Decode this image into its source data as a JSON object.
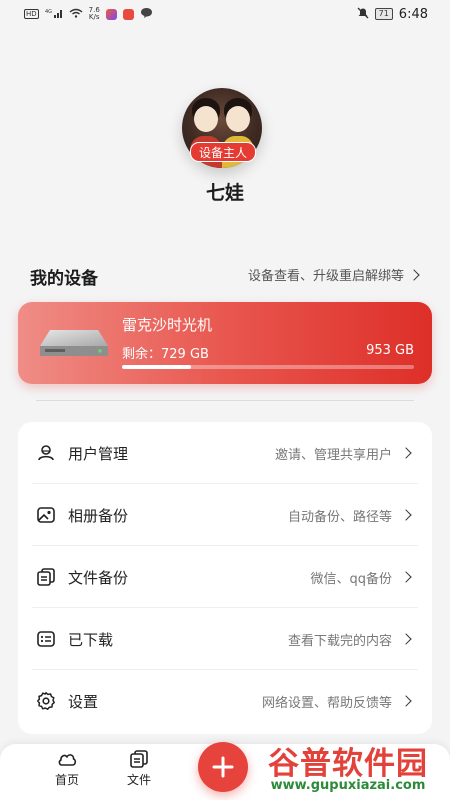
{
  "status_bar": {
    "hd": "HD",
    "signal_label": "4G",
    "speed_value": "7.6",
    "speed_unit": "K/s",
    "battery": "71",
    "time": "6:48"
  },
  "profile": {
    "badge": "设备主人",
    "name": "七娃"
  },
  "devices_section": {
    "title": "我的设备",
    "link": "设备查看、升级重启解绑等"
  },
  "device_card": {
    "name": "雷克沙时光机",
    "remaining_label": "剩余：729 GB",
    "total": "953 GB",
    "used_fraction": 0.235
  },
  "menu": {
    "items": [
      {
        "label": "用户管理",
        "hint": "邀请、管理共享用户",
        "icon": "user-icon"
      },
      {
        "label": "相册备份",
        "hint": "自动备份、路径等",
        "icon": "photo-icon"
      },
      {
        "label": "文件备份",
        "hint": "微信、qq备份",
        "icon": "files-icon"
      },
      {
        "label": "已下载",
        "hint": "查看下载完的内容",
        "icon": "download-list-icon"
      },
      {
        "label": "设置",
        "hint": "网络设置、帮助反馈等",
        "icon": "gear-icon"
      }
    ]
  },
  "bottom_nav": {
    "home": "首页",
    "files": "文件"
  },
  "watermark": {
    "title": "谷普软件园",
    "url": "www.gupuxiazai.com"
  },
  "colors": {
    "accent": "#e5433c",
    "card_start": "#ef8d86",
    "card_end": "#dd2f28",
    "watermark_url": "#2c8a3a"
  }
}
